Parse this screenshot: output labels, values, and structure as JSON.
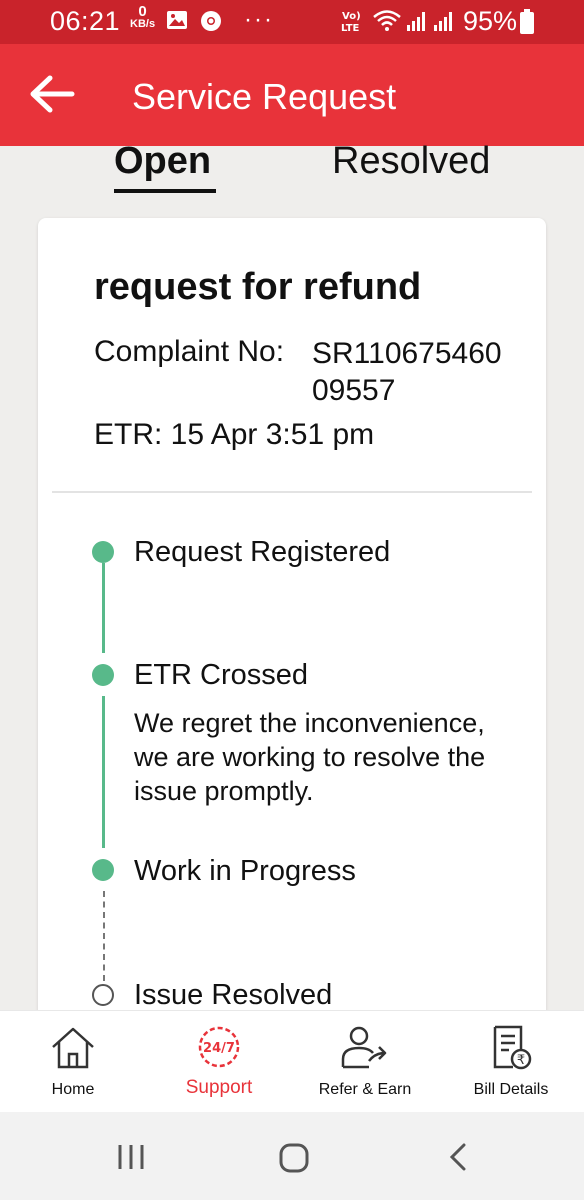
{
  "status_bar": {
    "time": "06:21",
    "data_speed_value": "0",
    "data_speed_unit": "KB/s",
    "more_indicator": "···",
    "battery_percent": "95%"
  },
  "app_bar": {
    "title": "Service Request"
  },
  "tabs": [
    {
      "label": "Open",
      "selected": true
    },
    {
      "label": "Resolved",
      "selected": false
    }
  ],
  "request": {
    "title": "request for refund",
    "complaint_label": "Complaint No:",
    "complaint_no": "SR11067546009557",
    "etr": "ETR: 15 Apr 3:51 pm"
  },
  "timeline": [
    {
      "label": "Request Registered",
      "status": "done"
    },
    {
      "label": "ETR Crossed",
      "status": "done",
      "description": "We regret the inconvenience, we are working to resolve the issue promptly."
    },
    {
      "label": "Work in Progress",
      "status": "done"
    },
    {
      "label": "Issue Resolved",
      "status": "pending"
    }
  ],
  "bottom_nav": [
    {
      "label": "Home",
      "icon": "home-icon",
      "active": false
    },
    {
      "label": "Support",
      "icon": "support-24-7-icon",
      "active": true
    },
    {
      "label": "Refer & Earn",
      "icon": "refer-earn-icon",
      "active": false
    },
    {
      "label": "Bill Details",
      "icon": "bill-details-icon",
      "active": false
    }
  ],
  "colors": {
    "app_bar": "#e8333a",
    "status_bar": "#c9232b",
    "timeline_done": "#58b98a",
    "active_nav": "#e8333a"
  }
}
